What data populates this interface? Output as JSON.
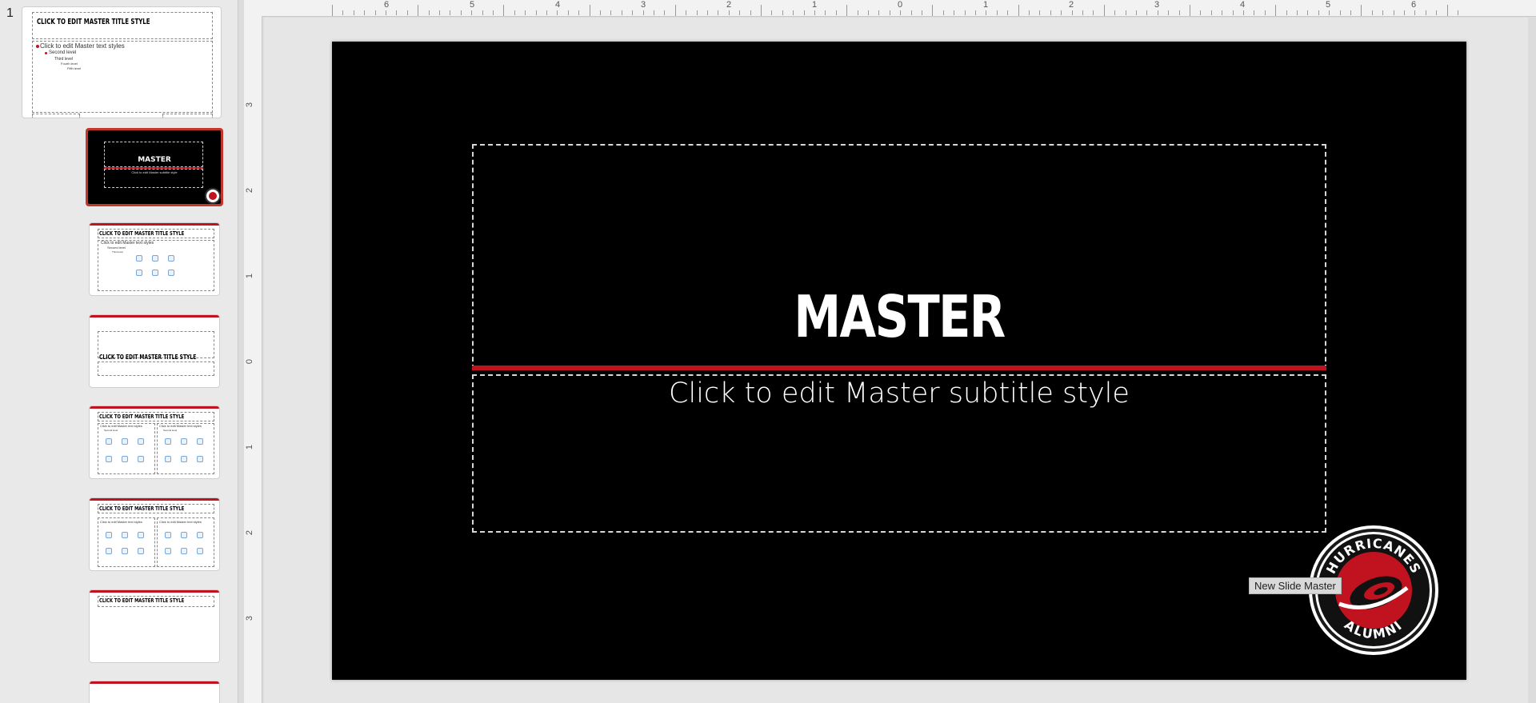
{
  "sidebar": {
    "slide_number": "1",
    "thumbnails": [
      {
        "title": "CLICK TO EDIT MASTER TITLE STYLE",
        "lines": [
          "Click to edit Master text styles",
          "Second level",
          "Third level",
          "Fourth level",
          "Fifth level"
        ]
      },
      {
        "title": "MASTER",
        "subtitle": "Click to edit Master subtitle style"
      },
      {
        "title": "CLICK TO EDIT MASTER TITLE STYLE",
        "lines": [
          "Click to edit Master text styles",
          "Second level",
          "Third level",
          "Fourth level",
          "Fifth level"
        ]
      },
      {
        "title": "CLICK TO EDIT MASTER TITLE STYLE"
      },
      {
        "title": "CLICK TO EDIT MASTER TITLE STYLE",
        "lines": [
          "Click to edit Master text styles",
          "Second level",
          "Click to edit Master text styles",
          "Second level"
        ]
      },
      {
        "title": "CLICK TO EDIT MASTER TITLE STYLE",
        "lines": [
          "Click to edit Master text styles",
          "Click to edit Master text styles"
        ]
      },
      {
        "title": "CLICK TO EDIT MASTER TITLE STYLE"
      }
    ]
  },
  "ruler": {
    "top": [
      "6",
      "5",
      "4",
      "3",
      "2",
      "1",
      "0",
      "1",
      "2",
      "3",
      "4",
      "5",
      "6"
    ],
    "left": [
      "3",
      "2",
      "1",
      "0",
      "1",
      "2",
      "3"
    ]
  },
  "slide": {
    "title": "MASTER",
    "subtitle": "Click to edit Master subtitle style",
    "logo_text_top": "HURRICANES",
    "logo_text_bottom": "ALUMNI",
    "tooltip": "New Slide Master"
  },
  "colors": {
    "accent": "#c1121f",
    "background": "#000000"
  }
}
